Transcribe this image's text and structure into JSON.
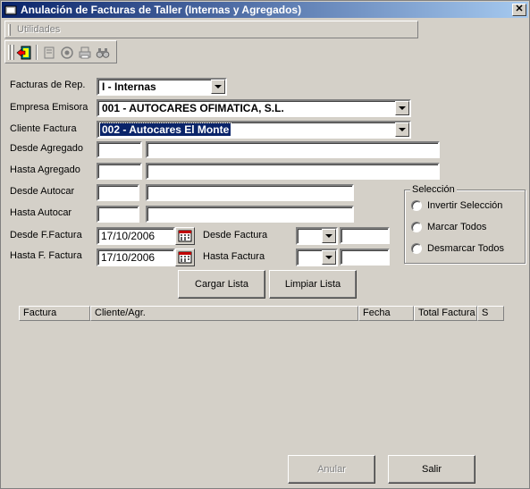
{
  "window": {
    "title": "Anulación de Facturas de Taller (Internas y Agregados)",
    "close_glyph": "✕"
  },
  "menu": {
    "utilidades": "Utilidades"
  },
  "toolbar": {
    "icons": [
      "exit-icon",
      "document-icon",
      "preview-icon",
      "print-icon",
      "binoculars-icon"
    ]
  },
  "form": {
    "facturas_rep": {
      "label": "Facturas de Rep.",
      "value": "I - Internas"
    },
    "empresa_emisora": {
      "label": "Empresa Emisora",
      "value": "001 - AUTOCARES OFIMATICA, S.L."
    },
    "cliente_factura": {
      "label": "Cliente Factura",
      "value": "002 - Autocares El Monte"
    },
    "desde_agregado": {
      "label": "Desde Agregado",
      "code": "",
      "name": ""
    },
    "hasta_agregado": {
      "label": "Hasta Agregado",
      "code": "",
      "name": ""
    },
    "desde_autocar": {
      "label": "Desde Autocar",
      "code": "",
      "name": ""
    },
    "hasta_autocar": {
      "label": "Hasta Autocar",
      "code": "",
      "name": ""
    },
    "desde_ffactura": {
      "label": "Desde F.Factura",
      "value": "17/10/2006"
    },
    "hasta_ffactura": {
      "label": "Hasta F. Factura",
      "value": "17/10/2006"
    },
    "desde_factura": {
      "label": "Desde Factura",
      "serie": "",
      "numero": ""
    },
    "hasta_factura": {
      "label": "Hasta Factura",
      "serie": "",
      "numero": ""
    }
  },
  "seleccion": {
    "legend": "Selección",
    "options": [
      "Invertir Selección",
      "Marcar Todos",
      "Desmarcar Todos"
    ]
  },
  "buttons": {
    "cargar": "Cargar Lista",
    "limpiar": "Limpiar Lista",
    "anular": "Anular",
    "salir": "Salir"
  },
  "grid": {
    "columns": [
      "Factura",
      "Cliente/Agr.",
      "Fecha",
      "Total Factura",
      "S"
    ]
  },
  "colors": {
    "title_start": "#0a246a",
    "title_end": "#a6caf0",
    "face": "#d4d0c8"
  }
}
